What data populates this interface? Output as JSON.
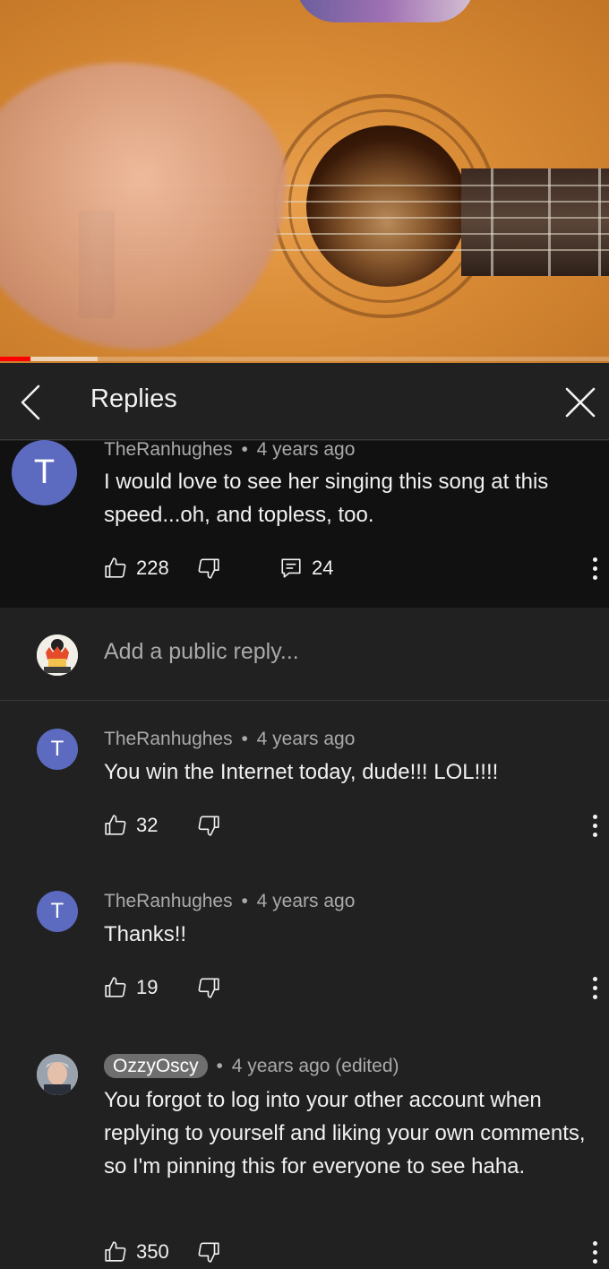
{
  "video": {
    "progress_percent": 5,
    "buffered_percent": 16
  },
  "header": {
    "title": "Replies"
  },
  "parent_comment": {
    "avatar_letter": "T",
    "author": "TheRanhughes",
    "separator": "•",
    "age": "4 years ago",
    "text": "I would love to see her singing this song at this speed...oh, and topless, too.",
    "likes": "228",
    "replies": "24"
  },
  "add_reply": {
    "placeholder": "Add a public reply..."
  },
  "replies": [
    {
      "avatar_letter": "T",
      "author": "TheRanhughes",
      "separator": "•",
      "age": "4 years ago",
      "text": "You win the Internet today, dude!!! LOL!!!!",
      "likes": "32"
    },
    {
      "avatar_letter": "T",
      "author": "TheRanhughes",
      "separator": "•",
      "age": "4 years ago",
      "text": "Thanks!!",
      "likes": "19"
    },
    {
      "author": "OzzyOscy",
      "separator": "•",
      "age": "4 years ago (edited)",
      "text": "You forgot to log into your other account when replying to yourself and liking your own comments, so I'm pinning this for everyone to see haha.",
      "likes": "350"
    }
  ],
  "colors": {
    "background": "#212121",
    "parent_background": "#111111",
    "avatar_purple": "#5c6bc0",
    "progress_red": "#ff0000",
    "secondary_text": "#aaaaaa"
  },
  "icons": {
    "back": "chevron-left-icon",
    "close": "close-icon",
    "like": "thumbs-up-icon",
    "dislike": "thumbs-down-icon",
    "reply": "comment-icon",
    "more": "more-vert-icon"
  }
}
